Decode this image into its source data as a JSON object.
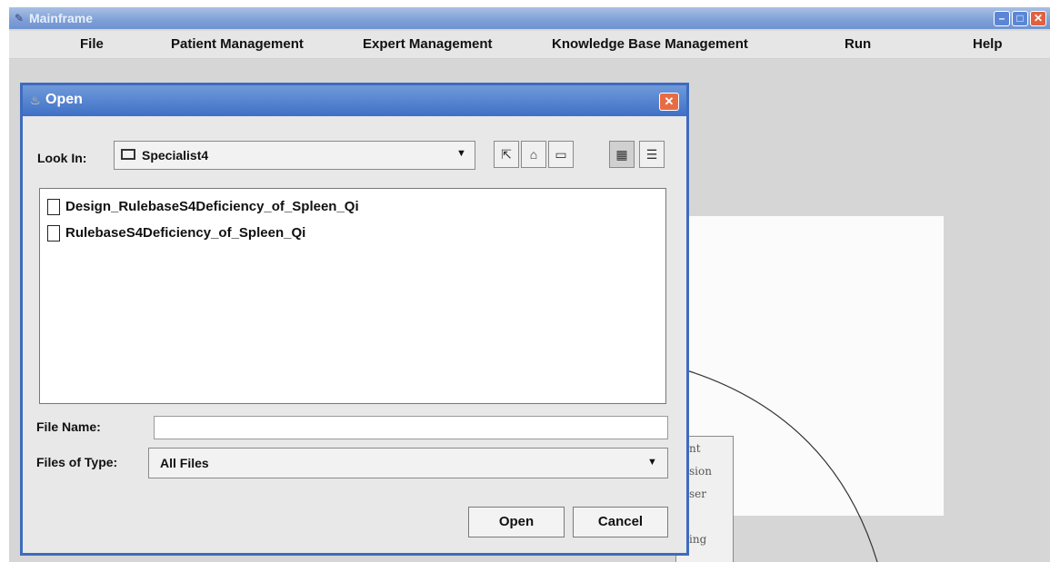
{
  "main_window": {
    "title": "Mainframe",
    "menu": [
      "File",
      "Patient Management",
      "Expert Management",
      "Knowledge Base Management",
      "Run",
      "Help"
    ]
  },
  "background": {
    "node_lines": [
      "nt",
      "sion",
      "ser",
      "ing"
    ]
  },
  "dialog": {
    "title": "Open",
    "look_in_label": "Look In:",
    "look_in_value": "Specialist4",
    "files": [
      "Design_RulebaseS4Deficiency_of_Spleen_Qi",
      "RulebaseS4Deficiency_of_Spleen_Qi"
    ],
    "file_name_label": "File Name:",
    "file_name_value": "",
    "files_of_type_label": "Files of Type:",
    "files_of_type_value": "All Files",
    "open_button": "Open",
    "cancel_button": "Cancel",
    "toolbar_icons": [
      "up-one-level-icon",
      "home-icon",
      "new-folder-icon",
      "list-view-icon",
      "details-view-icon"
    ]
  },
  "colors": {
    "titlebar": "#6f93d1",
    "dialog_border": "#3e6bbf",
    "close": "#e86c43"
  }
}
